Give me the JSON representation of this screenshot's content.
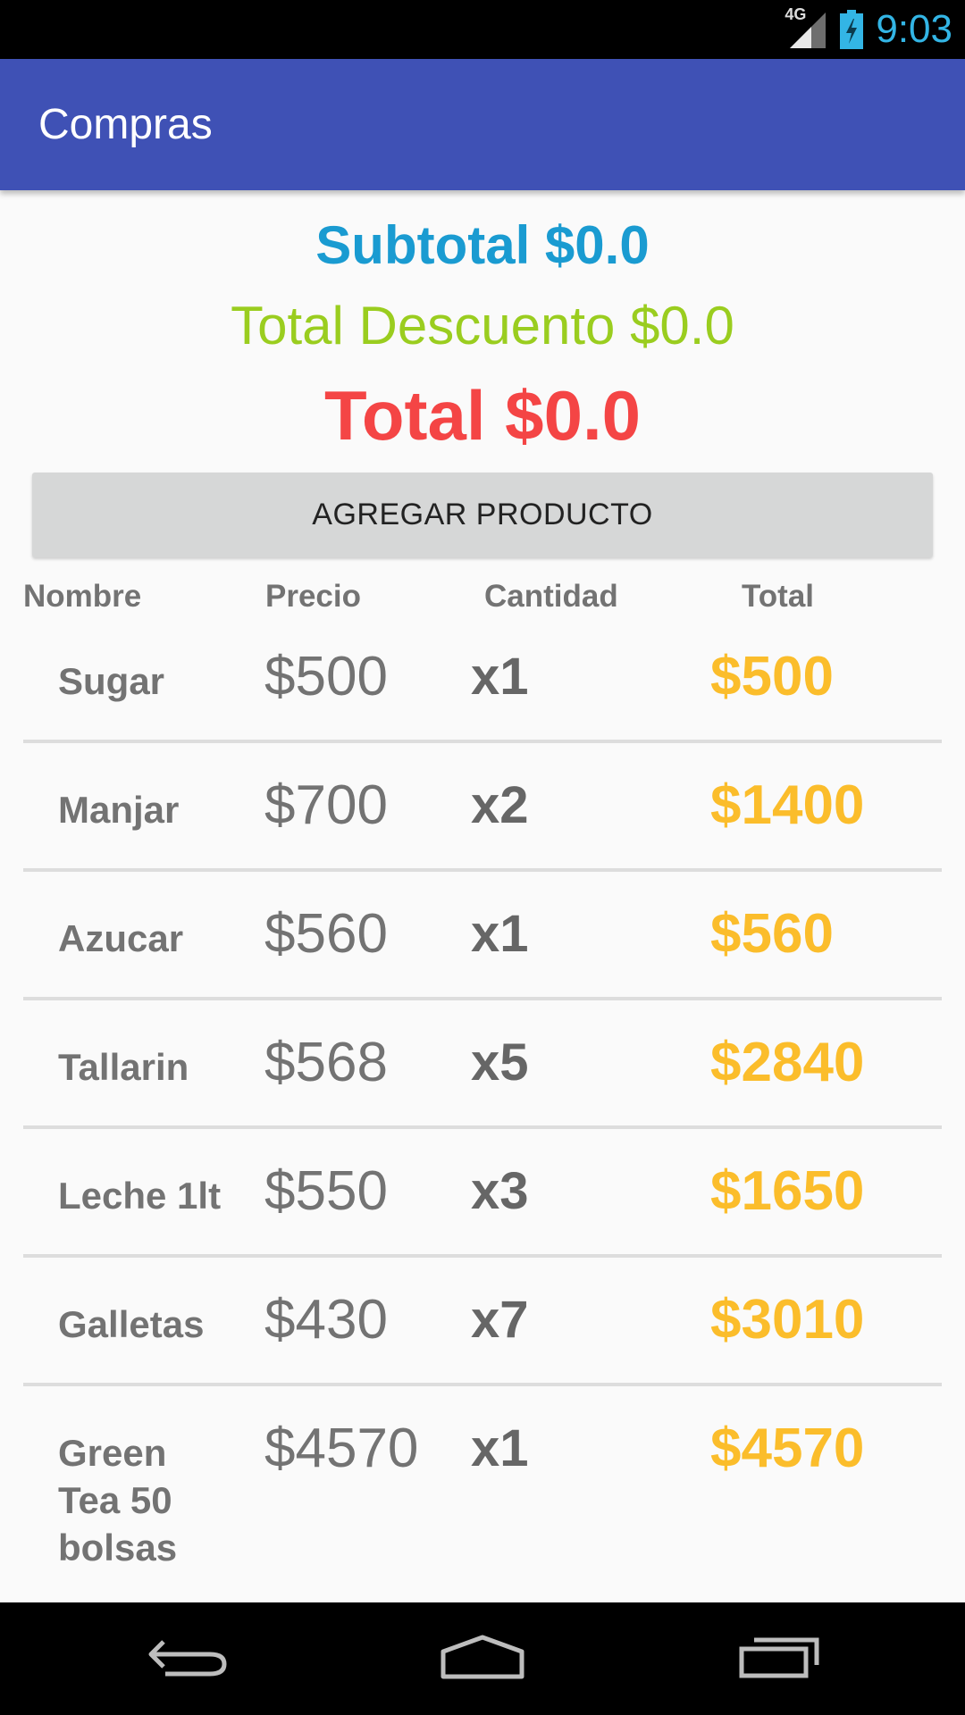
{
  "status_bar": {
    "network": "4G",
    "time": "9:03"
  },
  "app_bar": {
    "title": "Compras"
  },
  "summary": {
    "subtotal": "Subtotal $0.0",
    "descuento": "Total Descuento $0.0",
    "total": "Total $0.0"
  },
  "add_button_label": "AGREGAR PRODUCTO",
  "table": {
    "headers": [
      "Nombre",
      "Precio",
      "Cantidad",
      "Total"
    ],
    "rows": [
      {
        "name": "Sugar",
        "price": "$500",
        "qty": "x1",
        "total": "$500"
      },
      {
        "name": "Manjar",
        "price": "$700",
        "qty": "x2",
        "total": "$1400"
      },
      {
        "name": "Azucar",
        "price": "$560",
        "qty": "x1",
        "total": "$560"
      },
      {
        "name": "Tallarin",
        "price": "$568",
        "qty": "x5",
        "total": "$2840"
      },
      {
        "name": "Leche 1lt",
        "price": "$550",
        "qty": "x3",
        "total": "$1650"
      },
      {
        "name": "Galletas",
        "price": "$430",
        "qty": "x7",
        "total": "$3010"
      },
      {
        "name": "Green Tea 50 bolsas",
        "price": "$4570",
        "qty": "x1",
        "total": "$4570"
      }
    ]
  },
  "colors": {
    "app_bar": "#3f51b5",
    "subtotal": "#1a9bd1",
    "descuento": "#9acd1f",
    "total": "#f44545",
    "row_total": "#fbbd2b"
  },
  "icons": {
    "signal": "cell-signal-icon",
    "battery": "battery-charging-icon",
    "back": "back-icon",
    "home": "home-icon",
    "recents": "recents-icon"
  }
}
